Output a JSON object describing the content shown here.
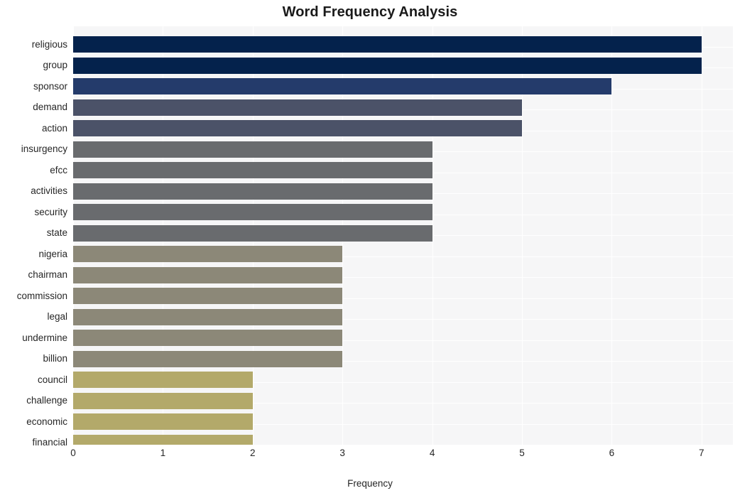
{
  "chart_data": {
    "type": "bar",
    "orientation": "horizontal",
    "title": "Word Frequency Analysis",
    "xlabel": "Frequency",
    "ylabel": "",
    "xlim": [
      0,
      7.35
    ],
    "xticks": [
      0,
      1,
      2,
      3,
      4,
      5,
      6,
      7
    ],
    "xtick_labels": [
      "0",
      "1",
      "2",
      "3",
      "4",
      "5",
      "6",
      "7"
    ],
    "grid": true,
    "grid_axis": "both",
    "legend": false,
    "categories": [
      "religious",
      "group",
      "sponsor",
      "demand",
      "action",
      "insurgency",
      "efcc",
      "activities",
      "security",
      "state",
      "nigeria",
      "chairman",
      "commission",
      "legal",
      "undermine",
      "billion",
      "council",
      "challenge",
      "economic",
      "financial"
    ],
    "values": [
      7,
      7,
      6,
      5,
      5,
      4,
      4,
      4,
      4,
      4,
      3,
      3,
      3,
      3,
      3,
      3,
      2,
      2,
      2,
      2
    ],
    "bar_colors": [
      "#04224c",
      "#04224c",
      "#243b6b",
      "#4b5268",
      "#4b5268",
      "#696b6e",
      "#696b6e",
      "#696b6e",
      "#696b6e",
      "#696b6e",
      "#8c8878",
      "#8c8878",
      "#8c8878",
      "#8c8878",
      "#8c8878",
      "#8c8878",
      "#b3a96a",
      "#b3a96a",
      "#b3a96a",
      "#b3a96a"
    ],
    "plot_background": "#f6f6f7",
    "grid_color": "#ffffff",
    "figure_background": "#ffffff"
  }
}
